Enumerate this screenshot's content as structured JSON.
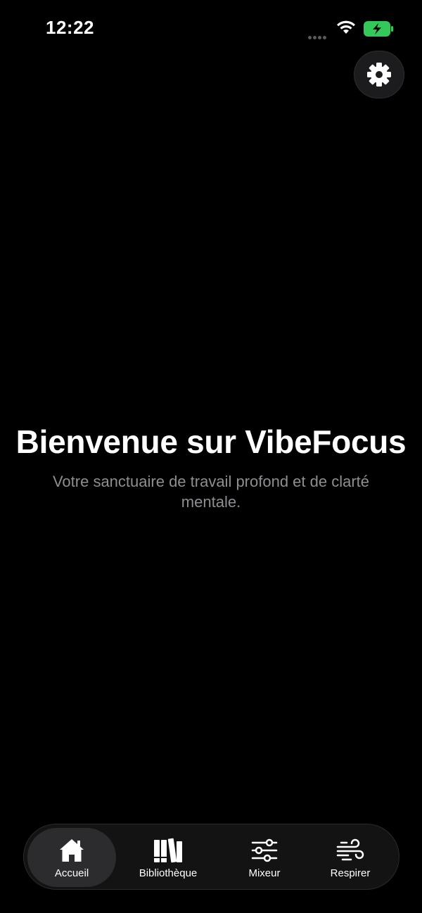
{
  "status_bar": {
    "time": "12:22",
    "battery_color": "#34c759"
  },
  "header": {
    "settings_icon": "gear-icon"
  },
  "hero": {
    "title": "Bienvenue sur VibeFocus",
    "subtitle": "Votre sanctuaire de travail profond et de clarté mentale."
  },
  "tab_bar": {
    "items": [
      {
        "label": "Accueil",
        "icon": "house-icon",
        "active": true
      },
      {
        "label": "Bibliothèque",
        "icon": "books-icon",
        "active": false
      },
      {
        "label": "Mixeur",
        "icon": "sliders-icon",
        "active": false
      },
      {
        "label": "Respirer",
        "icon": "wind-icon",
        "active": false
      }
    ]
  }
}
